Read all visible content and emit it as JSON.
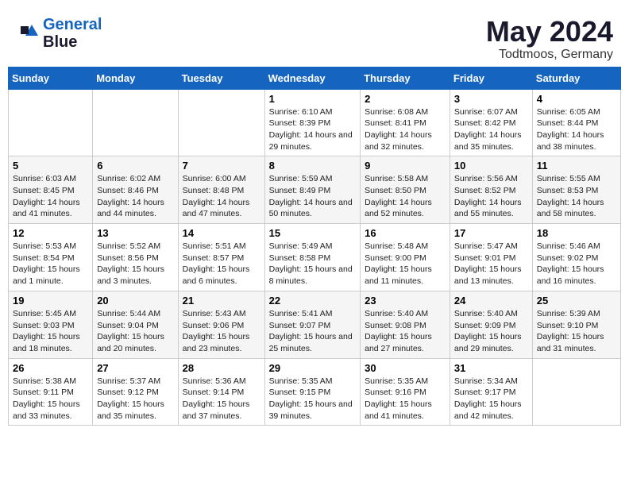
{
  "header": {
    "logo_line1": "General",
    "logo_line2": "Blue",
    "main_title": "May 2024",
    "subtitle": "Todtmoos, Germany"
  },
  "days_of_week": [
    "Sunday",
    "Monday",
    "Tuesday",
    "Wednesday",
    "Thursday",
    "Friday",
    "Saturday"
  ],
  "weeks": [
    [
      {
        "day": "",
        "sunrise": "",
        "sunset": "",
        "daylight": ""
      },
      {
        "day": "",
        "sunrise": "",
        "sunset": "",
        "daylight": ""
      },
      {
        "day": "",
        "sunrise": "",
        "sunset": "",
        "daylight": ""
      },
      {
        "day": "1",
        "sunrise": "Sunrise: 6:10 AM",
        "sunset": "Sunset: 8:39 PM",
        "daylight": "Daylight: 14 hours and 29 minutes."
      },
      {
        "day": "2",
        "sunrise": "Sunrise: 6:08 AM",
        "sunset": "Sunset: 8:41 PM",
        "daylight": "Daylight: 14 hours and 32 minutes."
      },
      {
        "day": "3",
        "sunrise": "Sunrise: 6:07 AM",
        "sunset": "Sunset: 8:42 PM",
        "daylight": "Daylight: 14 hours and 35 minutes."
      },
      {
        "day": "4",
        "sunrise": "Sunrise: 6:05 AM",
        "sunset": "Sunset: 8:44 PM",
        "daylight": "Daylight: 14 hours and 38 minutes."
      }
    ],
    [
      {
        "day": "5",
        "sunrise": "Sunrise: 6:03 AM",
        "sunset": "Sunset: 8:45 PM",
        "daylight": "Daylight: 14 hours and 41 minutes."
      },
      {
        "day": "6",
        "sunrise": "Sunrise: 6:02 AM",
        "sunset": "Sunset: 8:46 PM",
        "daylight": "Daylight: 14 hours and 44 minutes."
      },
      {
        "day": "7",
        "sunrise": "Sunrise: 6:00 AM",
        "sunset": "Sunset: 8:48 PM",
        "daylight": "Daylight: 14 hours and 47 minutes."
      },
      {
        "day": "8",
        "sunrise": "Sunrise: 5:59 AM",
        "sunset": "Sunset: 8:49 PM",
        "daylight": "Daylight: 14 hours and 50 minutes."
      },
      {
        "day": "9",
        "sunrise": "Sunrise: 5:58 AM",
        "sunset": "Sunset: 8:50 PM",
        "daylight": "Daylight: 14 hours and 52 minutes."
      },
      {
        "day": "10",
        "sunrise": "Sunrise: 5:56 AM",
        "sunset": "Sunset: 8:52 PM",
        "daylight": "Daylight: 14 hours and 55 minutes."
      },
      {
        "day": "11",
        "sunrise": "Sunrise: 5:55 AM",
        "sunset": "Sunset: 8:53 PM",
        "daylight": "Daylight: 14 hours and 58 minutes."
      }
    ],
    [
      {
        "day": "12",
        "sunrise": "Sunrise: 5:53 AM",
        "sunset": "Sunset: 8:54 PM",
        "daylight": "Daylight: 15 hours and 1 minute."
      },
      {
        "day": "13",
        "sunrise": "Sunrise: 5:52 AM",
        "sunset": "Sunset: 8:56 PM",
        "daylight": "Daylight: 15 hours and 3 minutes."
      },
      {
        "day": "14",
        "sunrise": "Sunrise: 5:51 AM",
        "sunset": "Sunset: 8:57 PM",
        "daylight": "Daylight: 15 hours and 6 minutes."
      },
      {
        "day": "15",
        "sunrise": "Sunrise: 5:49 AM",
        "sunset": "Sunset: 8:58 PM",
        "daylight": "Daylight: 15 hours and 8 minutes."
      },
      {
        "day": "16",
        "sunrise": "Sunrise: 5:48 AM",
        "sunset": "Sunset: 9:00 PM",
        "daylight": "Daylight: 15 hours and 11 minutes."
      },
      {
        "day": "17",
        "sunrise": "Sunrise: 5:47 AM",
        "sunset": "Sunset: 9:01 PM",
        "daylight": "Daylight: 15 hours and 13 minutes."
      },
      {
        "day": "18",
        "sunrise": "Sunrise: 5:46 AM",
        "sunset": "Sunset: 9:02 PM",
        "daylight": "Daylight: 15 hours and 16 minutes."
      }
    ],
    [
      {
        "day": "19",
        "sunrise": "Sunrise: 5:45 AM",
        "sunset": "Sunset: 9:03 PM",
        "daylight": "Daylight: 15 hours and 18 minutes."
      },
      {
        "day": "20",
        "sunrise": "Sunrise: 5:44 AM",
        "sunset": "Sunset: 9:04 PM",
        "daylight": "Daylight: 15 hours and 20 minutes."
      },
      {
        "day": "21",
        "sunrise": "Sunrise: 5:43 AM",
        "sunset": "Sunset: 9:06 PM",
        "daylight": "Daylight: 15 hours and 23 minutes."
      },
      {
        "day": "22",
        "sunrise": "Sunrise: 5:41 AM",
        "sunset": "Sunset: 9:07 PM",
        "daylight": "Daylight: 15 hours and 25 minutes."
      },
      {
        "day": "23",
        "sunrise": "Sunrise: 5:40 AM",
        "sunset": "Sunset: 9:08 PM",
        "daylight": "Daylight: 15 hours and 27 minutes."
      },
      {
        "day": "24",
        "sunrise": "Sunrise: 5:40 AM",
        "sunset": "Sunset: 9:09 PM",
        "daylight": "Daylight: 15 hours and 29 minutes."
      },
      {
        "day": "25",
        "sunrise": "Sunrise: 5:39 AM",
        "sunset": "Sunset: 9:10 PM",
        "daylight": "Daylight: 15 hours and 31 minutes."
      }
    ],
    [
      {
        "day": "26",
        "sunrise": "Sunrise: 5:38 AM",
        "sunset": "Sunset: 9:11 PM",
        "daylight": "Daylight: 15 hours and 33 minutes."
      },
      {
        "day": "27",
        "sunrise": "Sunrise: 5:37 AM",
        "sunset": "Sunset: 9:12 PM",
        "daylight": "Daylight: 15 hours and 35 minutes."
      },
      {
        "day": "28",
        "sunrise": "Sunrise: 5:36 AM",
        "sunset": "Sunset: 9:14 PM",
        "daylight": "Daylight: 15 hours and 37 minutes."
      },
      {
        "day": "29",
        "sunrise": "Sunrise: 5:35 AM",
        "sunset": "Sunset: 9:15 PM",
        "daylight": "Daylight: 15 hours and 39 minutes."
      },
      {
        "day": "30",
        "sunrise": "Sunrise: 5:35 AM",
        "sunset": "Sunset: 9:16 PM",
        "daylight": "Daylight: 15 hours and 41 minutes."
      },
      {
        "day": "31",
        "sunrise": "Sunrise: 5:34 AM",
        "sunset": "Sunset: 9:17 PM",
        "daylight": "Daylight: 15 hours and 42 minutes."
      },
      {
        "day": "",
        "sunrise": "",
        "sunset": "",
        "daylight": ""
      }
    ]
  ]
}
